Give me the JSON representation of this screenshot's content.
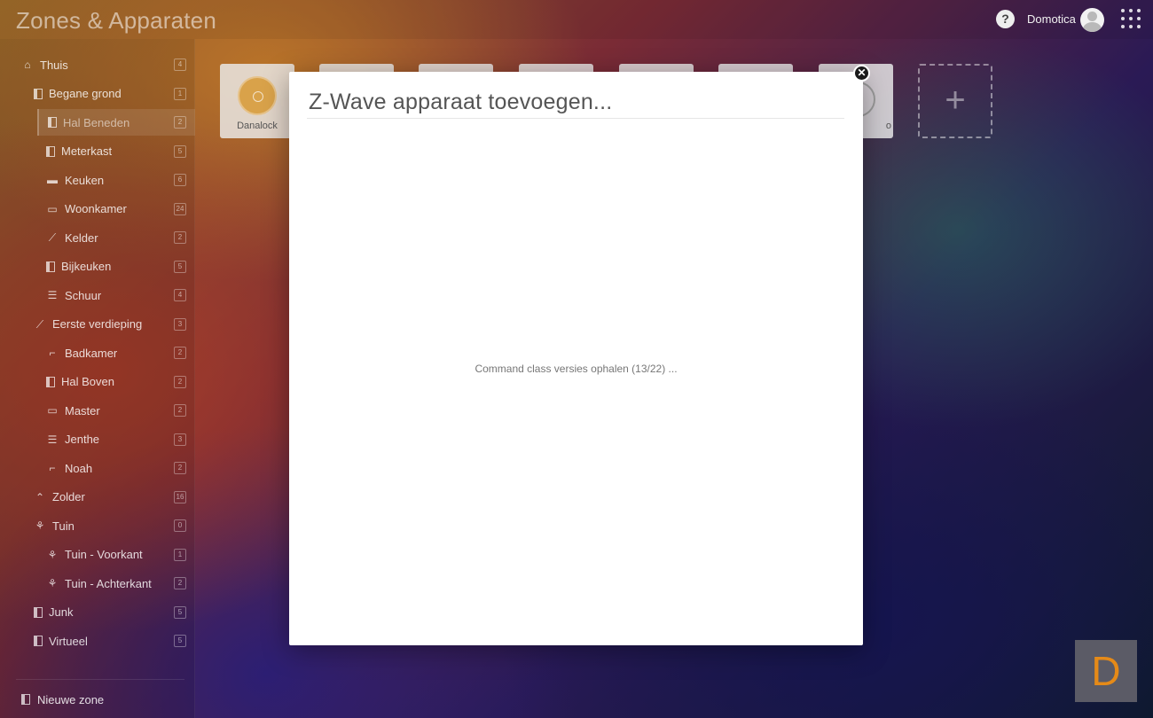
{
  "header": {
    "title": "Zones & Apparaten",
    "user_name": "Domotica"
  },
  "sidebar": {
    "zones": [
      {
        "label": "Thuis",
        "count": "4",
        "icon": "home-icon"
      },
      {
        "label": "Begane grond",
        "count": "1",
        "icon": "door-icon"
      },
      {
        "label": "Hal Beneden",
        "count": "2",
        "icon": "door-icon",
        "active": true
      },
      {
        "label": "Meterkast",
        "count": "5",
        "icon": "door-icon"
      },
      {
        "label": "Keuken",
        "count": "6",
        "icon": "kitchen-icon"
      },
      {
        "label": "Woonkamer",
        "count": "24",
        "icon": "sofa-icon"
      },
      {
        "label": "Kelder",
        "count": "2",
        "icon": "stairs-icon"
      },
      {
        "label": "Bijkeuken",
        "count": "5",
        "icon": "door-icon"
      },
      {
        "label": "Schuur",
        "count": "4",
        "icon": "shed-icon"
      },
      {
        "label": "Eerste verdieping",
        "count": "3",
        "icon": "stairs-icon"
      },
      {
        "label": "Badkamer",
        "count": "2",
        "icon": "shower-icon"
      },
      {
        "label": "Hal Boven",
        "count": "2",
        "icon": "door-icon"
      },
      {
        "label": "Master",
        "count": "2",
        "icon": "bed-icon"
      },
      {
        "label": "Jenthe",
        "count": "3",
        "icon": "shed-icon"
      },
      {
        "label": "Noah",
        "count": "2",
        "icon": "shower-icon"
      },
      {
        "label": "Zolder",
        "count": "16",
        "icon": "attic-icon"
      },
      {
        "label": "Tuin",
        "count": "0",
        "icon": "garden-icon"
      },
      {
        "label": "Tuin - Voorkant",
        "count": "1",
        "icon": "garden-icon"
      },
      {
        "label": "Tuin - Achterkant",
        "count": "2",
        "icon": "garden-icon"
      },
      {
        "label": "Junk",
        "count": "5",
        "icon": "door-icon"
      },
      {
        "label": "Virtueel",
        "count": "5",
        "icon": "door-icon"
      }
    ],
    "new_zone_label": "Nieuwe zone"
  },
  "devices": {
    "first_label": "Danalock",
    "partial_label": "o",
    "add_symbol": "+"
  },
  "modal": {
    "title": "Z-Wave apparaat toevoegen...",
    "status": "Command class versies ophalen (13/22) ...",
    "close_symbol": "✕"
  },
  "watermark": {
    "letter": "D"
  },
  "colors": {
    "accent": "#d9a24a",
    "watermark_bg": "#5b5b66",
    "watermark_fg": "#e58a18"
  }
}
